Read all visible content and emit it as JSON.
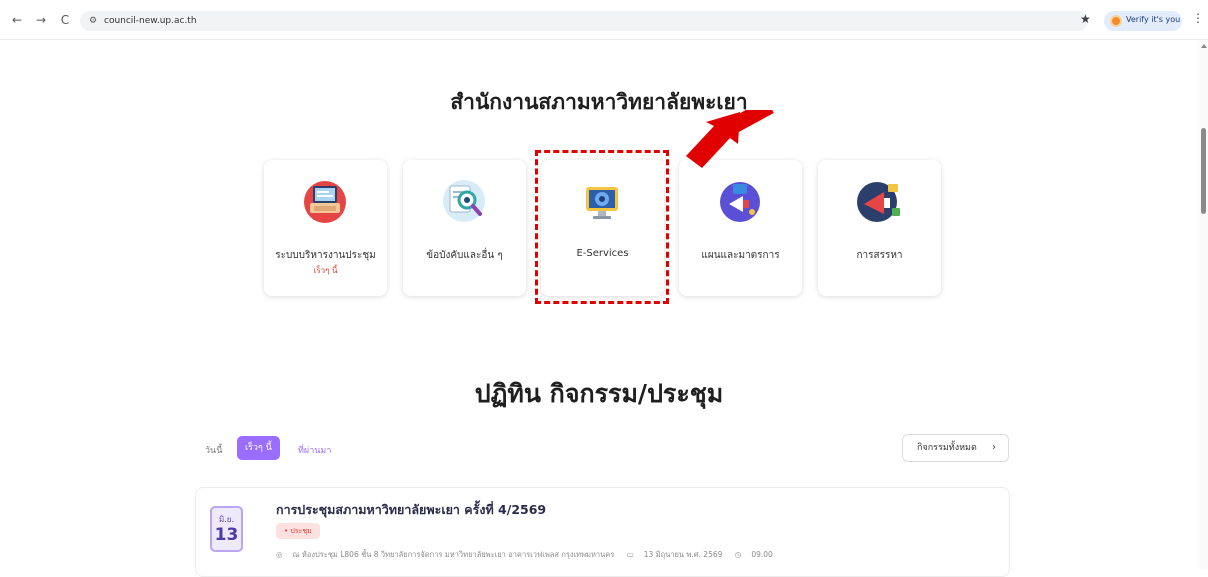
{
  "browser": {
    "url": "council-new.up.ac.th",
    "back_icon": "←",
    "forward_icon": "→",
    "reload_icon": "C",
    "site_icon": "⚙",
    "star_icon": "★",
    "menu_icon": "⋮",
    "profile_label": "Verify it's you"
  },
  "page": {
    "title": "สำนักงานสภามหาวิทยาลัยพะเยา",
    "services": [
      {
        "label": "ระบบบริหารงานประชุม",
        "sub": "เร็วๆ นี้",
        "icon": "laptop-icon"
      },
      {
        "label": "ข้อบังคับและอื่น ๆ",
        "sub": "",
        "icon": "document-search-icon"
      },
      {
        "label": "E-Services",
        "sub": "",
        "icon": "monitor-gear-icon"
      },
      {
        "label": "แผนและมาตรการ",
        "sub": "",
        "icon": "megaphone-icon"
      },
      {
        "label": "การสรรหา",
        "sub": "",
        "icon": "announcement-icon"
      }
    ],
    "activities_title": "ปฏิทิน กิจกรรม/ประชุม",
    "tabs": {
      "today": "วันนี้",
      "upcoming": "เร็วๆ นี้",
      "past": "ที่ผ่านมา"
    },
    "all_activities_label": "กิจกรรมทั้งหมด",
    "event": {
      "month": "มิ.ย.",
      "day": "13",
      "title": "การประชุมสภามหาวิทยาลัยพะเยา ครั้งที่ 4/2569",
      "badge": "• ประชุม",
      "location": "ณ ห้องประชุม L806 ชั้น 8 วิทยาลัยการจัดการ มหาวิทยาลัยพะเยา อาคารเวฟเพลส กรุงเทพมหานคร",
      "date": "13 มิถุนายน พ.ศ. 2569",
      "time": "09.00"
    }
  },
  "colors": {
    "accent": "#9b6dff",
    "highlight": "#e10000",
    "arrow": "#e10000"
  }
}
